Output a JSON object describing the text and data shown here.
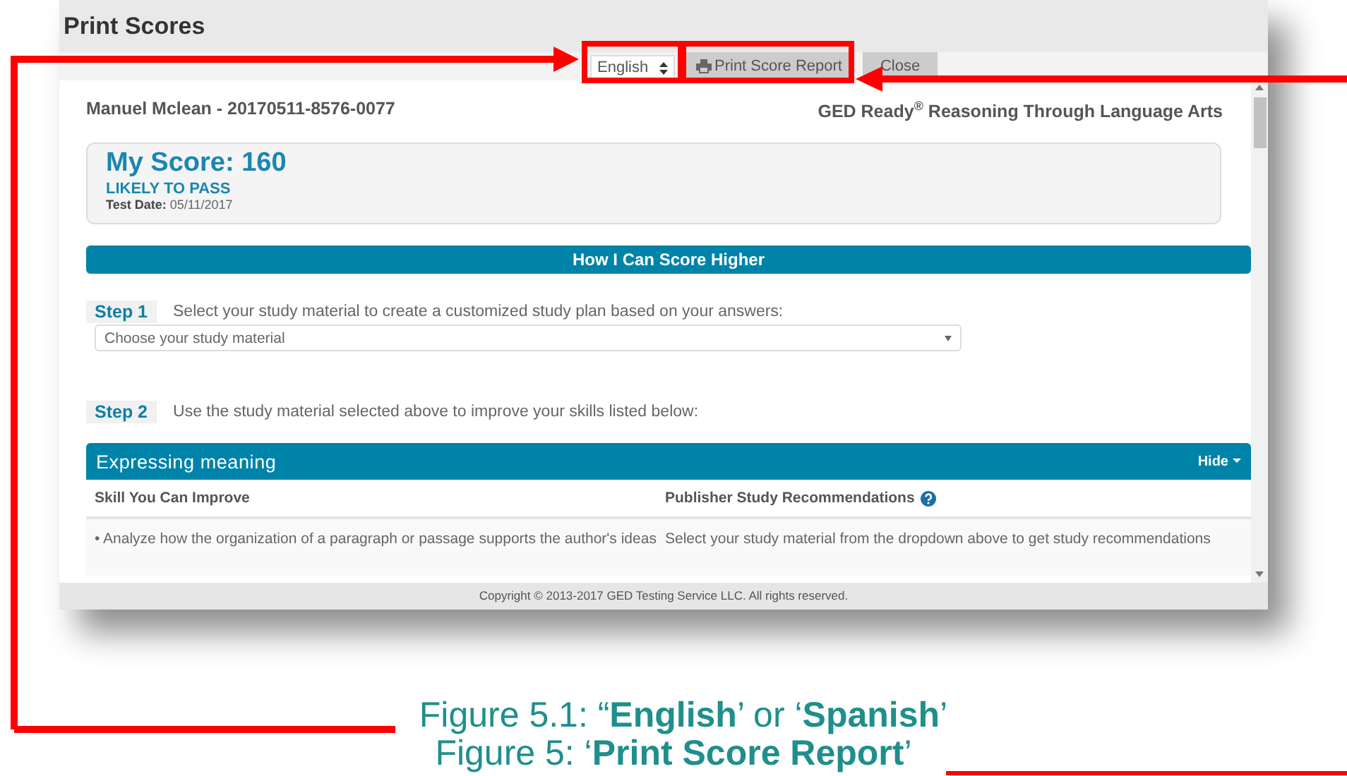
{
  "window": {
    "title": "Print Scores"
  },
  "toolbar": {
    "language": {
      "value": "English"
    },
    "print_button": {
      "label": "Print Score Report"
    },
    "close_button": {
      "label": "Close"
    }
  },
  "report": {
    "candidate": "Manuel Mclean - 20170511-8576-0077",
    "test_name": "GED Ready$^{®}$ Reasoning Through Language Arts",
    "score": {
      "title": "My Score: 160",
      "status": "LIKELY TO PASS",
      "date_label": "Test Date:",
      "date": "05/11/2017"
    },
    "section_title": "How I Can Score Higher",
    "steps": [
      {
        "label": "Step 1",
        "text": "Select your study material to create a customized study plan based on your answers:"
      },
      {
        "label": "Step 2",
        "text": "Use the study material selected above to improve your skills listed below:"
      }
    ],
    "study_material": {
      "placeholder": "Choose your study material"
    },
    "skill_group": {
      "title": "Expressing meaning",
      "toggle": "Hide",
      "columns": [
        "Skill You Can Improve",
        "Publisher Study Recommendations"
      ],
      "rows": [
        [
          "• Analyze how the organization of a paragraph or passage supports the author's ideas",
          "Select your study material from the dropdown above to get study recommendations"
        ]
      ]
    }
  },
  "footer": "Copyright © 2013-2017 GED Testing Service LLC. All rights reserved.",
  "captions": [
    "Figure 5.1: “**English**’ or ‘**Spanish**’",
    "Figure 5: ‘**Print Score Report**’"
  ]
}
